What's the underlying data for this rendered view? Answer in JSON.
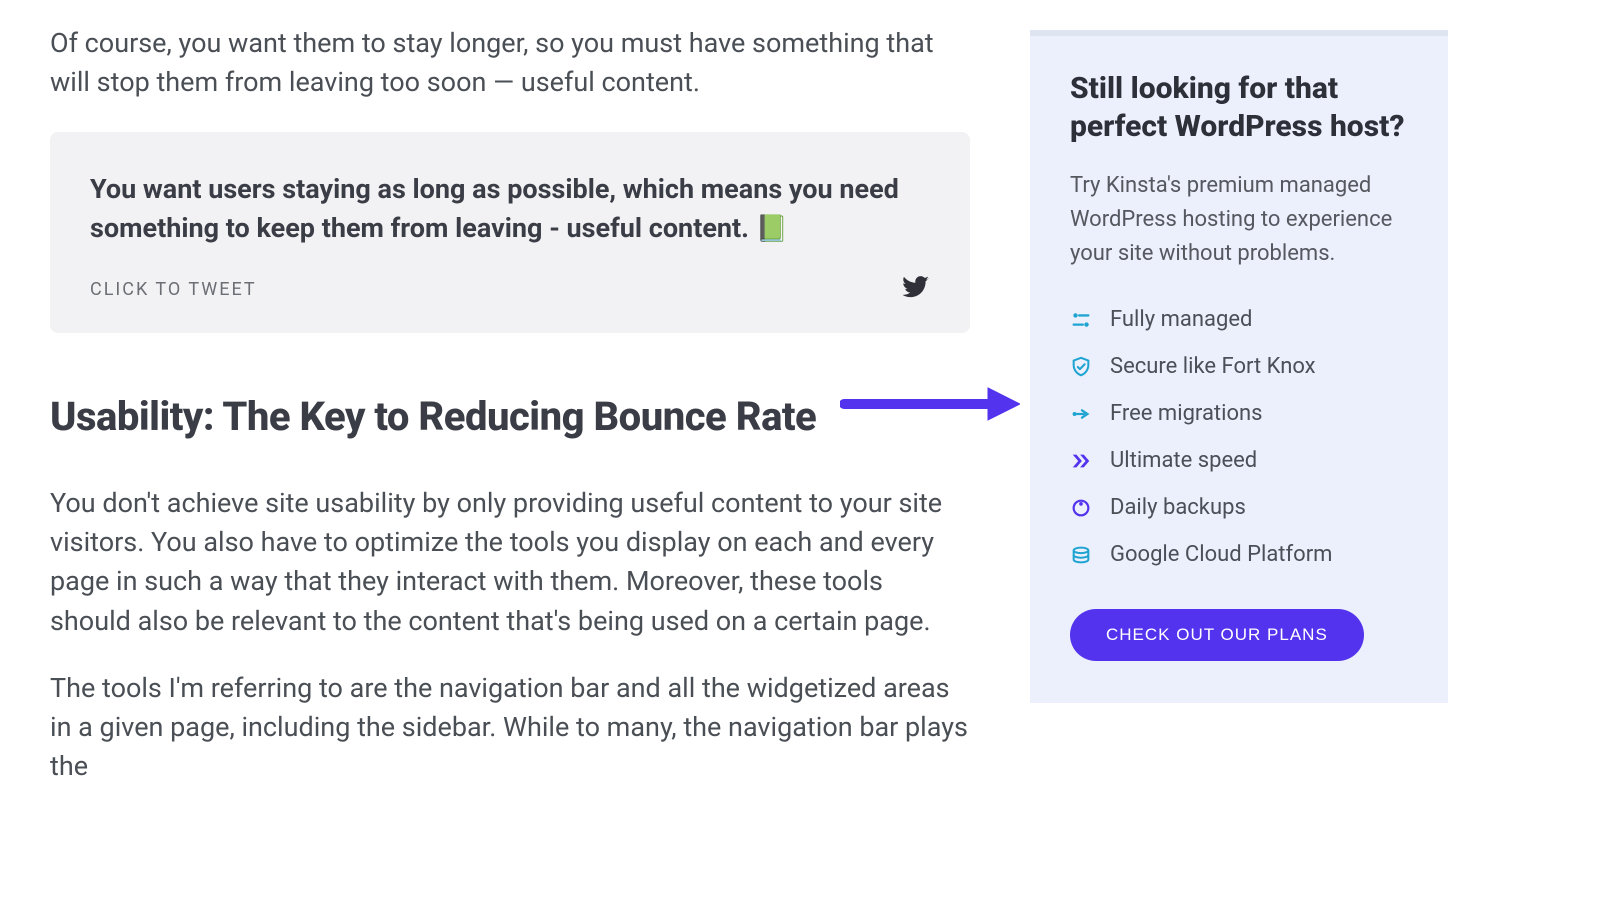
{
  "article": {
    "intro_para": "Of course, you want them to stay longer, so you must have something that will stop them from leaving too soon — useful content.",
    "tweet_quote": "You want users staying as long as possible, which means you need something to keep them from leaving - useful content. ",
    "ctt_label": "CLICK TO TWEET",
    "section_heading": "Usability: The Key to Reducing Bounce Rate",
    "body_para_1": "You don't achieve site usability by only providing useful content to your site visitors. You also have to optimize the tools you display on each and every page in such a way that they interact with them. Moreover, these tools should also be relevant to the content that's being used on a certain page.",
    "body_para_2": "The tools I'm referring to are the navigation bar and all the widgetized areas in a given page, including the sidebar. While to many, the navigation bar plays the"
  },
  "sidebar": {
    "title": "Still looking for that perfect WordPress host?",
    "desc": "Try Kinsta's premium managed WordPress hosting to experience your site without problems.",
    "features": {
      "0": "Fully managed",
      "1": "Secure like Fort Knox",
      "2": "Free migrations",
      "3": "Ultimate speed",
      "4": "Daily backups",
      "5": "Google Cloud Platform"
    },
    "cta": "CHECK OUT OUR PLANS"
  }
}
